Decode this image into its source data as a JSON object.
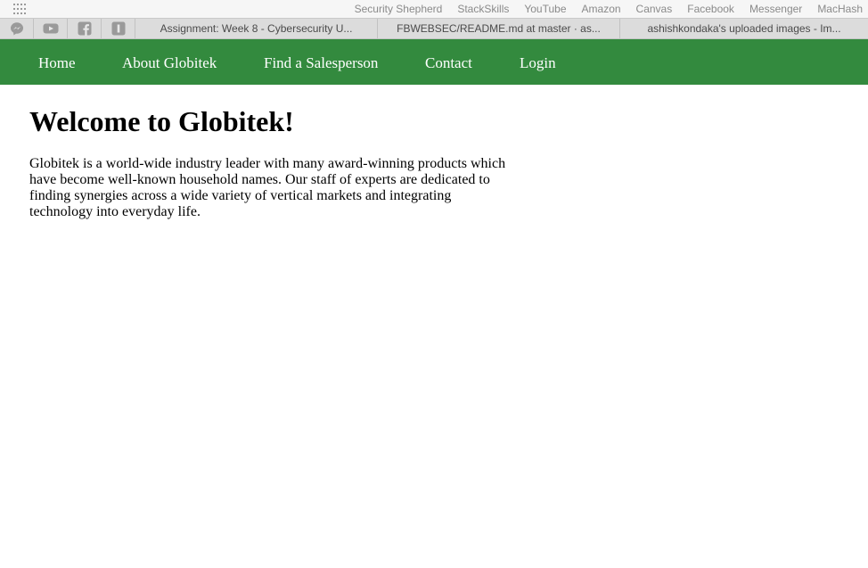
{
  "bookmarks_bar": {
    "apps_icon": "apps-grid-icon",
    "items": [
      "Security Shepherd",
      "StackSkills",
      "YouTube",
      "Amazon",
      "Canvas",
      "Facebook",
      "Messenger",
      "MacHash"
    ]
  },
  "tabs": {
    "pinned": [
      {
        "icon": "messenger-icon"
      },
      {
        "icon": "youtube-icon"
      },
      {
        "icon": "facebook-icon"
      },
      {
        "icon": "instapaper-icon"
      }
    ],
    "items": [
      {
        "title": "Assignment: Week 8 - Cybersecurity U..."
      },
      {
        "title": "FBWEBSEC/README.md at master · as..."
      },
      {
        "title": "ashishkondaka's uploaded images - Im..."
      }
    ]
  },
  "site_nav": {
    "background": "#338a3e",
    "home": "Home",
    "about": "About Globitek",
    "find": "Find a Salesperson",
    "contact": "Contact",
    "login": "Login"
  },
  "main": {
    "title": "Welcome to Globitek!",
    "intro": "Globitek is a world-wide industry leader with many award-winning products which have become well-known household names. Our staff of experts are dedicated to finding synergies across a wide variety of vertical markets and integrating technology into everyday life."
  }
}
